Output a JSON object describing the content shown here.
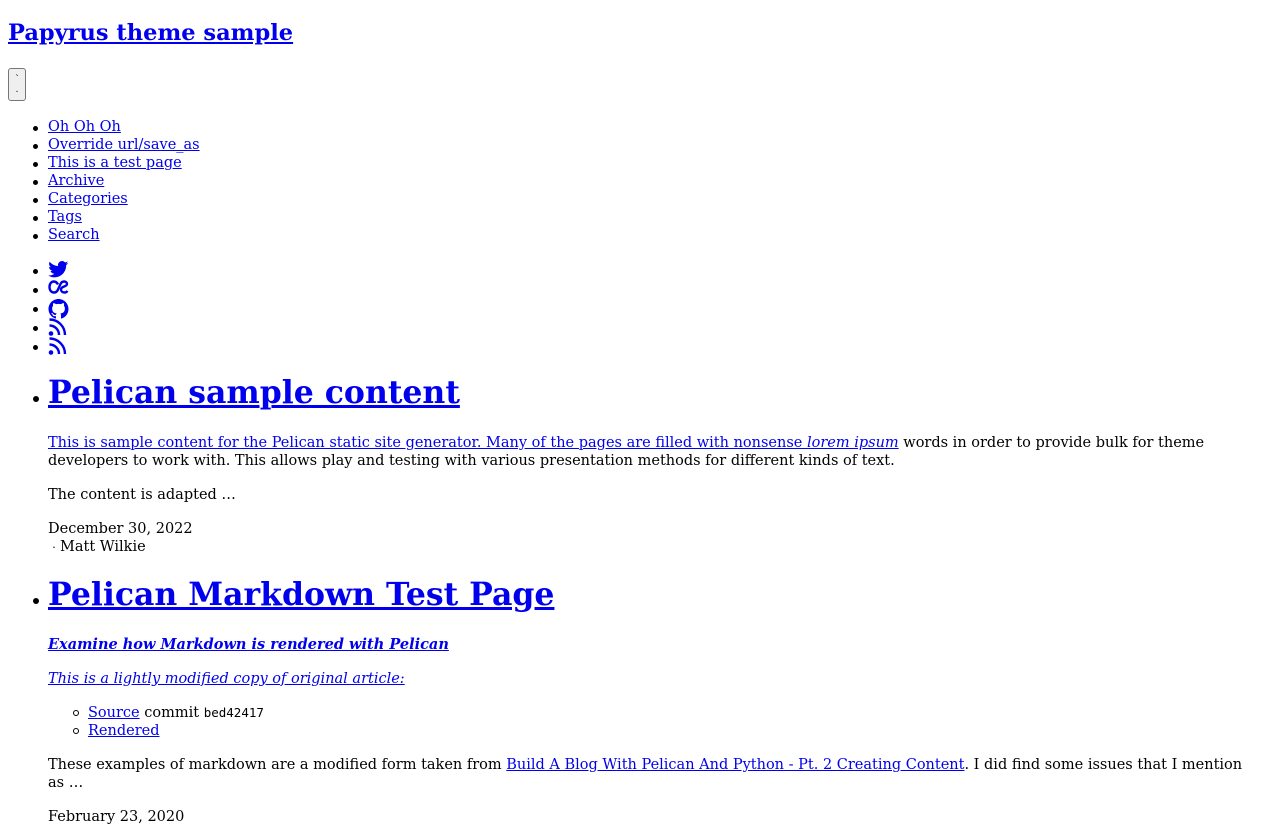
{
  "header": {
    "site_title": "Papyrus theme sample",
    "menu_toggle_glyph_top": "`",
    "menu_toggle_glyph_bottom": "."
  },
  "nav": {
    "items": [
      {
        "label": "Oh Oh Oh"
      },
      {
        "label": "Override url/save_as"
      },
      {
        "label": "This is a test page"
      },
      {
        "label": "Archive"
      },
      {
        "label": "Categories"
      },
      {
        "label": "Tags"
      },
      {
        "label": "Search"
      }
    ]
  },
  "social": {
    "icons": [
      "twitter-icon",
      "lastfm-icon",
      "github-icon",
      "rss-icon",
      "rss-icon"
    ]
  },
  "articles": [
    {
      "title": "Pelican sample content",
      "summary_link": "This is sample content for the Pelican static site generator. Many of the pages are filled with nonsense ",
      "summary_link_em": "lorem ipsum",
      "summary_rest": " words in order to provide bulk for theme developers to work with. This allows play and testing with various presentation methods for different kinds of text.",
      "summary_more": "The content is adapted …",
      "date": "December 30, 2022",
      "author_sep": "·",
      "author": "Matt Wilkie"
    },
    {
      "title": "Pelican Markdown Test Page",
      "subtitle": "Examine how Markdown is rendered with Pelican",
      "intro_link": "This is a lightly modified copy of original article:",
      "links": [
        {
          "label": "Source",
          "text": " commit ",
          "code": "bed42417"
        },
        {
          "label": "Rendered"
        }
      ],
      "body_before": "These examples of markdown are a modified form taken from ",
      "body_link": "Build A Blog With Pelican And Python - Pt. 2 Creating Content",
      "body_after": ". I did find some issues that I mention as …",
      "date": "February 23, 2020"
    }
  ]
}
